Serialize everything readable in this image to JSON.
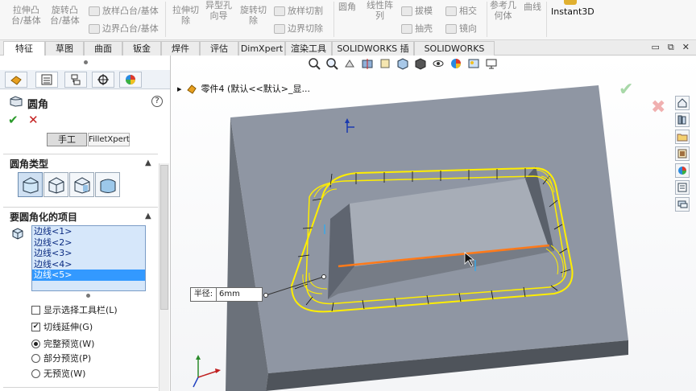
{
  "ribbon": {
    "items": [
      {
        "id": "extruded-boss",
        "label": "拉伸凸\n台/基体"
      },
      {
        "id": "revolved-boss",
        "label": "旋转凸\n台/基体"
      },
      {
        "id": "swept-boss",
        "label": "放样凸台/基体"
      },
      {
        "id": "boundary-boss",
        "label": "边界凸台/基体"
      },
      {
        "id": "extruded-cut",
        "label": "拉伸切\n除"
      },
      {
        "id": "hole-wizard",
        "label": "异型孔\n向导"
      },
      {
        "id": "revolved-cut",
        "label": "旋转切\n除"
      },
      {
        "id": "lofted-cut",
        "label": "放样切割"
      },
      {
        "id": "boundary-cut",
        "label": "边界切除"
      },
      {
        "id": "fillet",
        "label": "圆角"
      },
      {
        "id": "linear-pattern",
        "label": "线性阵\n列"
      },
      {
        "id": "draft",
        "label": "拔模"
      },
      {
        "id": "shell",
        "label": "抽壳"
      },
      {
        "id": "intersect",
        "label": "相交"
      },
      {
        "id": "mirror",
        "label": "镜向"
      },
      {
        "id": "reference-geometry",
        "label": "参考几\n何体"
      },
      {
        "id": "curves",
        "label": "曲线"
      },
      {
        "id": "instant3d",
        "label": "Instant3D"
      }
    ]
  },
  "tabs": [
    {
      "label": "特征",
      "active": true
    },
    {
      "label": "草图"
    },
    {
      "label": "曲面"
    },
    {
      "label": "钣金"
    },
    {
      "label": "焊件"
    },
    {
      "label": "评估"
    },
    {
      "label": "DimXpert"
    },
    {
      "label": "渲染工具"
    },
    {
      "label": "SOLIDWORKS 插件"
    },
    {
      "label": "SOLIDWORKS MBD"
    }
  ],
  "window_controls": [
    "▭",
    "⧉",
    "✕"
  ],
  "property_manager": {
    "title": "圆角",
    "help": "?",
    "ok": "✔",
    "cancel": "✕",
    "modes": {
      "manual": "手工",
      "filletxpert": "FilletXpert"
    },
    "fillet_type_section": "圆角类型",
    "items_section": "要圆角化的项目",
    "edges": [
      "边线<1>",
      "边线<2>",
      "边线<3>",
      "边线<4>",
      "边线<5>"
    ],
    "selected_edge": "边线<5>",
    "options": {
      "show_selection_toolbar": "显示选择工具栏(L)",
      "tangent_propagation": "切线延伸(G)",
      "full_preview": "完整预览(W)",
      "partial_preview": "部分预览(P)",
      "no_preview": "无预览(W)"
    },
    "values": {
      "show_selection_toolbar": false,
      "tangent_propagation": true,
      "preview": "full"
    }
  },
  "viewport": {
    "tree_label": "零件4  (默认<<默认>_显...",
    "radius_label": "半径:",
    "radius_value": "6mm"
  },
  "colors": {
    "model_top": "#8f96a3",
    "model_side": "#6b717a",
    "preview": "#ffee00",
    "selected_edge": "#ff7a1a"
  }
}
